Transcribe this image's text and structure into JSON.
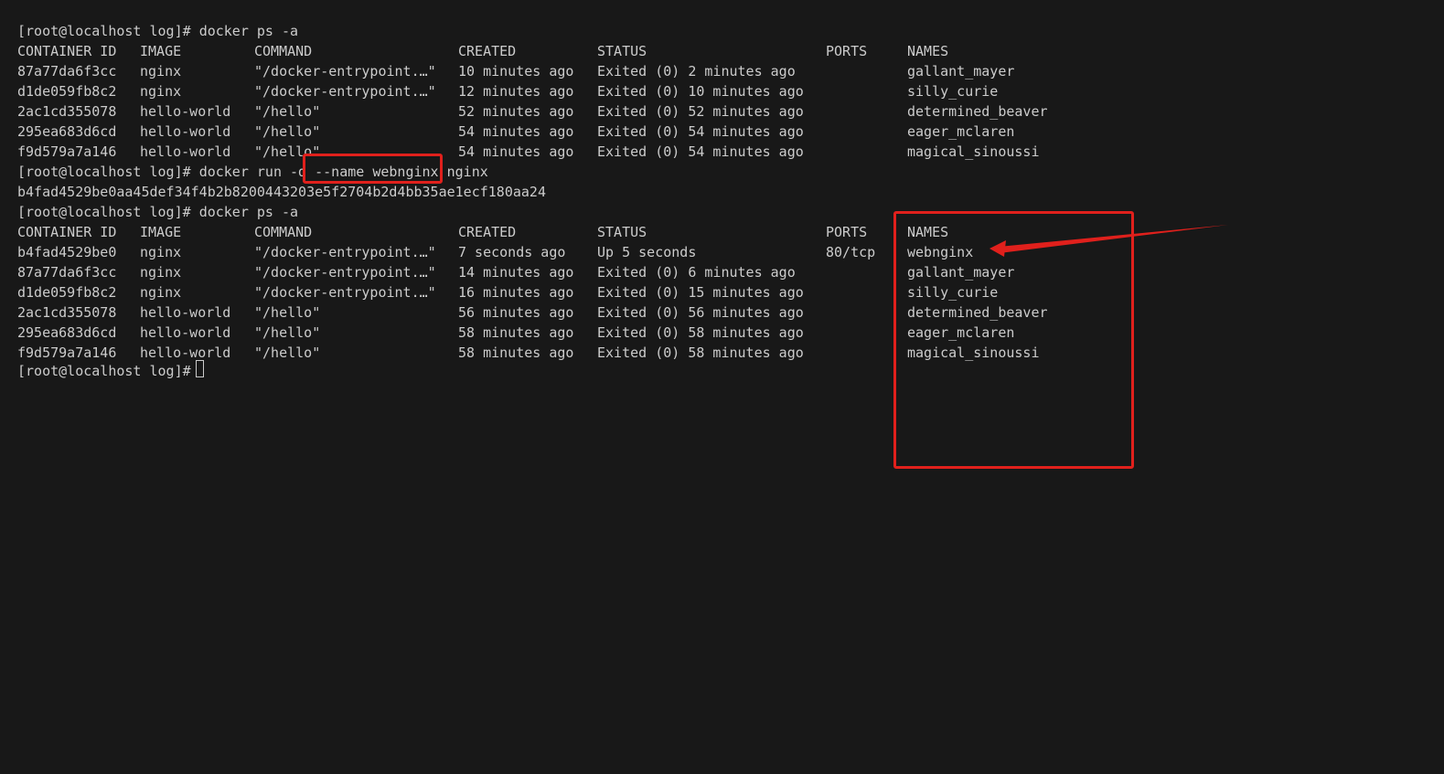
{
  "terminal": {
    "prompt": "[root@localhost log]# ",
    "cmd1": "docker ps -a",
    "cmd2_before": "docker run -d ",
    "cmd2_flag": "--name webnginx",
    "cmd2_after": " nginx",
    "container_hash": "b4fad4529be0aa45def34f4b2b8200443203e5f2704b2d4bb35ae1ecf180aa24",
    "cmd3": "docker ps -a",
    "headers": {
      "id": "CONTAINER ID",
      "image": "IMAGE",
      "command": "COMMAND",
      "created": "CREATED",
      "status": "STATUS",
      "ports": "PORTS",
      "names": "NAMES"
    },
    "table1": [
      {
        "id": "87a77da6f3cc",
        "image": "nginx",
        "command": "\"/docker-entrypoint.…\"",
        "created": "10 minutes ago",
        "status": "Exited (0) 2 minutes ago",
        "ports": "",
        "names": "gallant_mayer"
      },
      {
        "id": "d1de059fb8c2",
        "image": "nginx",
        "command": "\"/docker-entrypoint.…\"",
        "created": "12 minutes ago",
        "status": "Exited (0) 10 minutes ago",
        "ports": "",
        "names": "silly_curie"
      },
      {
        "id": "2ac1cd355078",
        "image": "hello-world",
        "command": "\"/hello\"",
        "created": "52 minutes ago",
        "status": "Exited (0) 52 minutes ago",
        "ports": "",
        "names": "determined_beaver"
      },
      {
        "id": "295ea683d6cd",
        "image": "hello-world",
        "command": "\"/hello\"",
        "created": "54 minutes ago",
        "status": "Exited (0) 54 minutes ago",
        "ports": "",
        "names": "eager_mclaren"
      },
      {
        "id": "f9d579a7a146",
        "image": "hello-world",
        "command": "\"/hello\"",
        "created": "54 minutes ago",
        "status": "Exited (0) 54 minutes ago",
        "ports": "",
        "names": "magical_sinoussi"
      }
    ],
    "table2": [
      {
        "id": "b4fad4529be0",
        "image": "nginx",
        "command": "\"/docker-entrypoint.…\"",
        "created": "7 seconds ago",
        "status": "Up 5 seconds",
        "ports": "80/tcp",
        "names": "webnginx"
      },
      {
        "id": "87a77da6f3cc",
        "image": "nginx",
        "command": "\"/docker-entrypoint.…\"",
        "created": "14 minutes ago",
        "status": "Exited (0) 6 minutes ago",
        "ports": "",
        "names": "gallant_mayer"
      },
      {
        "id": "d1de059fb8c2",
        "image": "nginx",
        "command": "\"/docker-entrypoint.…\"",
        "created": "16 minutes ago",
        "status": "Exited (0) 15 minutes ago",
        "ports": "",
        "names": "silly_curie"
      },
      {
        "id": "2ac1cd355078",
        "image": "hello-world",
        "command": "\"/hello\"",
        "created": "56 minutes ago",
        "status": "Exited (0) 56 minutes ago",
        "ports": "",
        "names": "determined_beaver"
      },
      {
        "id": "295ea683d6cd",
        "image": "hello-world",
        "command": "\"/hello\"",
        "created": "58 minutes ago",
        "status": "Exited (0) 58 minutes ago",
        "ports": "",
        "names": "eager_mclaren"
      },
      {
        "id": "f9d579a7a146",
        "image": "hello-world",
        "command": "\"/hello\"",
        "created": "58 minutes ago",
        "status": "Exited (0) 58 minutes ago",
        "ports": "",
        "names": "magical_sinoussi"
      }
    ]
  },
  "colors": {
    "background": "#181818",
    "text": "#cccccc",
    "annotation": "#e0201c"
  }
}
